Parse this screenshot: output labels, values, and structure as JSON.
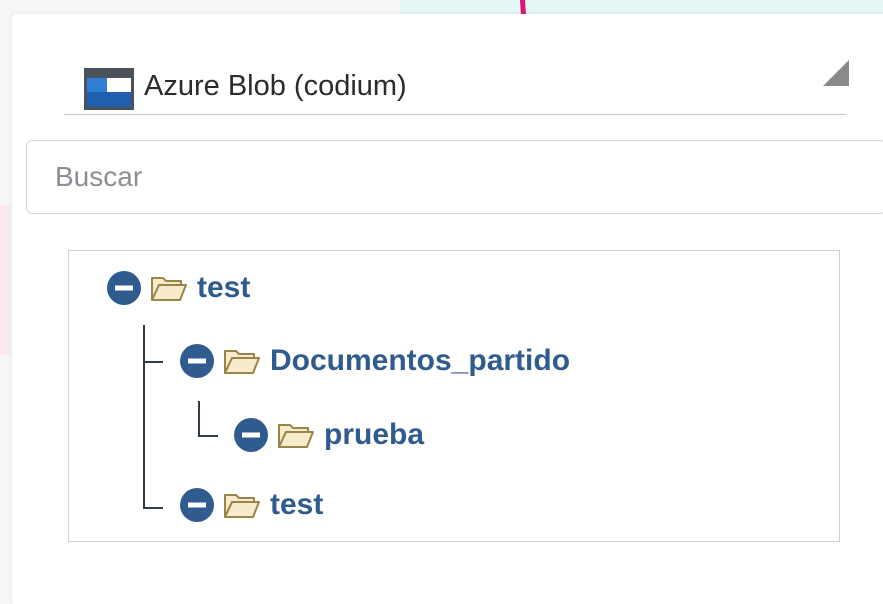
{
  "source": {
    "label": "Azure Blob (codium)",
    "icon": "azure-blob-icon"
  },
  "search": {
    "placeholder": "Buscar",
    "value": ""
  },
  "tree": {
    "nodes": [
      {
        "label": "test",
        "expanded": true,
        "level": 0
      },
      {
        "label": "Documentos_partido",
        "expanded": true,
        "level": 1
      },
      {
        "label": "prueba",
        "expanded": true,
        "level": 2
      },
      {
        "label": "test",
        "expanded": true,
        "level": 1
      }
    ]
  },
  "colors": {
    "label": "#2f5b8e",
    "toggle": "#2f5b8e",
    "folder_fill": "#f6eccb",
    "folder_stroke": "#9b8448",
    "accent_stroke": "#e0157a"
  }
}
